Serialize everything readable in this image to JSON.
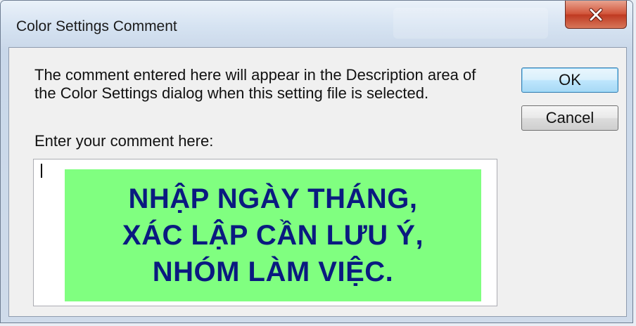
{
  "window": {
    "title": "Color Settings Comment"
  },
  "dialog": {
    "description": "The comment entered here will appear in the Description area of the Color Settings dialog when this setting file is selected.",
    "prompt_label": "Enter your comment here:",
    "comment_value": "",
    "buttons": {
      "ok_label": "OK",
      "cancel_label": "Cancel"
    },
    "overlay_banner": {
      "lines": [
        "NHẬP NGÀY THÁNG,",
        "XÁC LẬP CẦN LƯU Ý,",
        "NHÓM LÀM VIỆC."
      ],
      "background_color": "#80ff80",
      "text_color": "#0a1a80"
    }
  },
  "icons": {
    "close": "close-icon"
  }
}
